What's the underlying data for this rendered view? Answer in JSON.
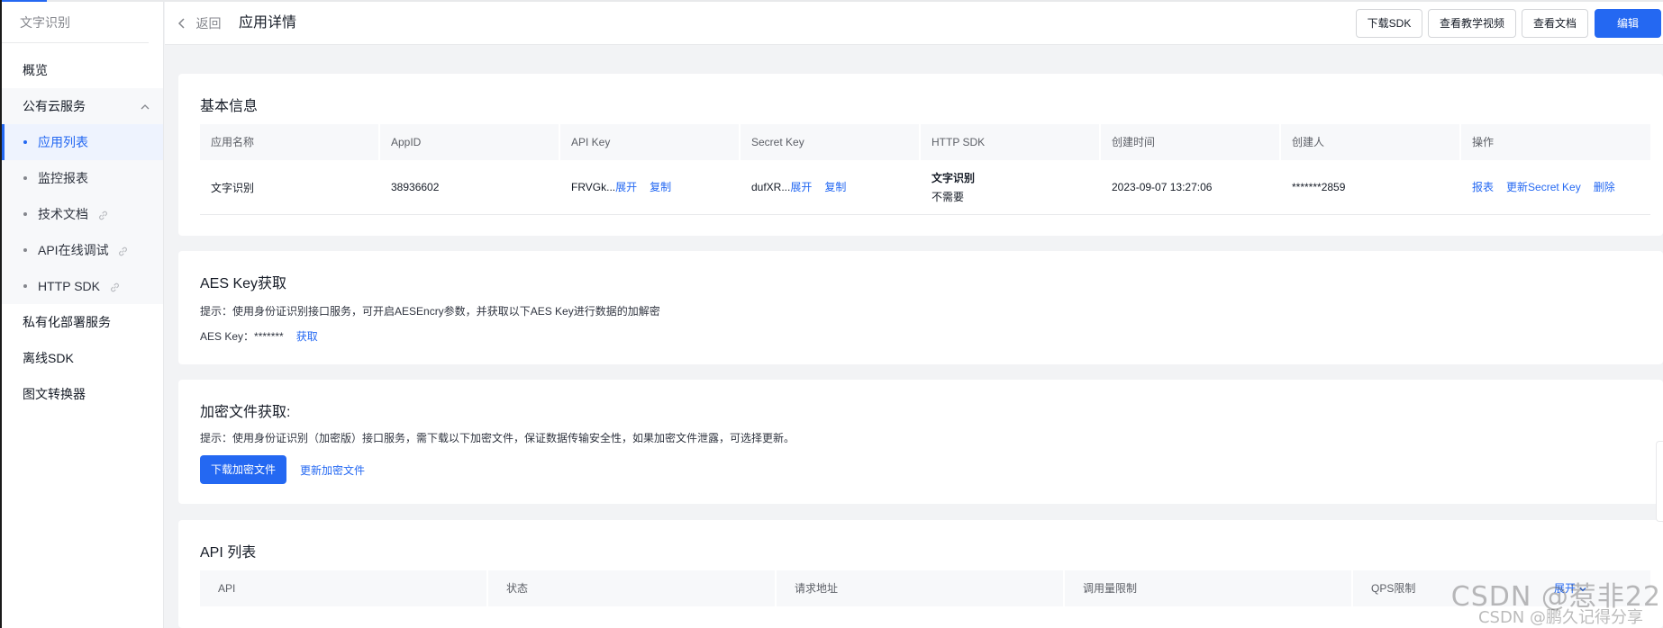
{
  "sidebar": {
    "title": "文字识别",
    "items": {
      "overview": "概览",
      "public_cloud": "公有云服务",
      "app_list": "应用列表",
      "monitor": "监控报表",
      "tech_docs": "技术文档",
      "api_debug": "API在线调试",
      "http_sdk": "HTTP SDK",
      "private": "私有化部署服务",
      "offline_sdk": "离线SDK",
      "converter": "图文转换器"
    }
  },
  "header": {
    "back": "返回",
    "title": "应用详情",
    "btn_download_sdk": "下载SDK",
    "btn_video": "查看教学视频",
    "btn_docs": "查看文档",
    "btn_edit": "编辑"
  },
  "basic_info": {
    "title": "基本信息",
    "columns": [
      "应用名称",
      "AppID",
      "API Key",
      "Secret Key",
      "HTTP SDK",
      "创建时间",
      "创建人",
      "操作"
    ],
    "row": {
      "app_name": "文字识别",
      "app_id": "38936602",
      "api_key": "FRVGk...",
      "secret_key": "dufXR...",
      "expand": "展开",
      "copy": "复制",
      "http_sdk_name": "文字识别",
      "http_sdk_need": "不需要",
      "created_at": "2023-09-07 13:27:06",
      "creator": "*******2859",
      "op_report": "报表",
      "op_update_secret": "更新Secret Key",
      "op_delete": "删除"
    }
  },
  "aes": {
    "title": "AES Key获取",
    "hint": "提示：使用身份证识别接口服务，可开启AESEncry参数，并获取以下AES Key进行数据的加解密",
    "key_label": "AES Key：*******",
    "get": "获取"
  },
  "encrypt": {
    "title": "加密文件获取:",
    "hint": "提示：使用身份证识别（加密版）接口服务，需下载以下加密文件，保证数据传输安全性，如果加密文件泄露，可选择更新。",
    "download": "下载加密文件",
    "update": "更新加密文件"
  },
  "api_list": {
    "title": "API 列表",
    "columns": [
      "API",
      "状态",
      "请求地址",
      "调用量限制",
      "QPS限制"
    ],
    "expand": "展开"
  },
  "watermark": {
    "line1": "CSDN @惹非22",
    "line2": "CSDN @鹏久记得分享"
  },
  "colors": {
    "accent": "#2468f2"
  }
}
